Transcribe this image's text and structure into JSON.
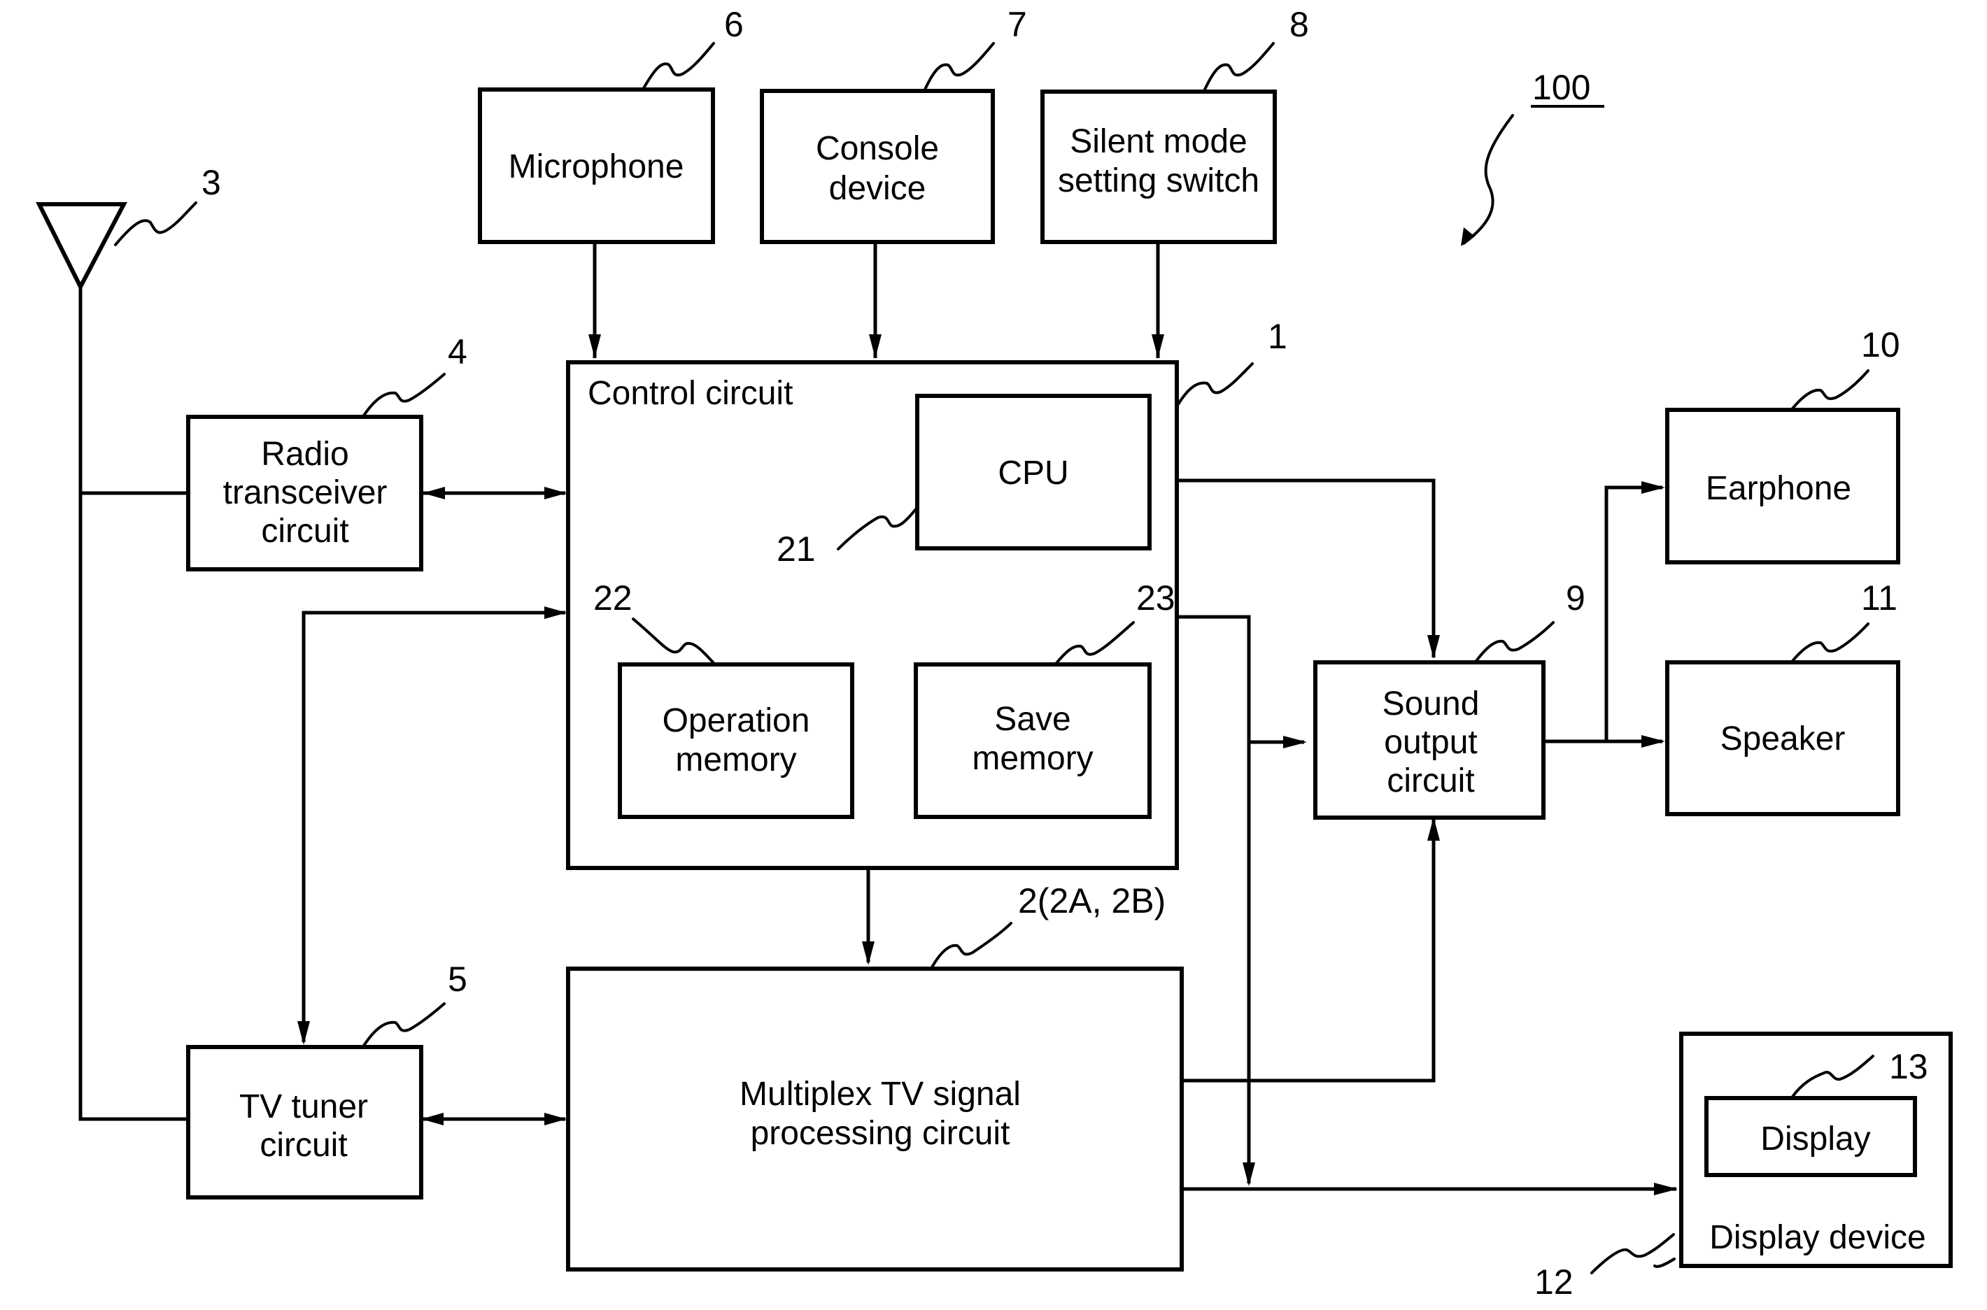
{
  "figure": {
    "reference": "100",
    "colors": {
      "ink": "#000000",
      "paper": "#ffffff"
    }
  },
  "blocks": {
    "control": {
      "label": "Control circuit",
      "ref": "1"
    },
    "multiplex": {
      "lines": [
        "Multiplex TV signal",
        "processing circuit"
      ],
      "ref": "2(2A, 2B)"
    },
    "antenna": {
      "ref": "3"
    },
    "radio": {
      "lines": [
        "Radio",
        "transceiver",
        "circuit"
      ],
      "ref": "4"
    },
    "tv_tuner": {
      "lines": [
        "TV tuner",
        "circuit"
      ],
      "ref": "5"
    },
    "microphone": {
      "lines": [
        "Microphone"
      ],
      "ref": "6"
    },
    "console": {
      "lines": [
        "Console",
        "device"
      ],
      "ref": "7"
    },
    "silent_switch": {
      "lines": [
        "Silent mode",
        "setting switch"
      ],
      "ref": "8"
    },
    "sound_output": {
      "lines": [
        "Sound",
        "output",
        "circuit"
      ],
      "ref": "9"
    },
    "earphone": {
      "lines": [
        "Earphone"
      ],
      "ref": "10"
    },
    "speaker": {
      "lines": [
        "Speaker"
      ],
      "ref": "11"
    },
    "display_device": {
      "label": "Display device",
      "ref": "12"
    },
    "display": {
      "lines": [
        "Display"
      ],
      "ref": "13"
    },
    "cpu": {
      "lines": [
        "CPU"
      ],
      "ref": "21"
    },
    "operation_memory": {
      "lines": [
        "Operation",
        "memory"
      ],
      "ref": "22"
    },
    "save_memory": {
      "lines": [
        "Save",
        "memory"
      ],
      "ref": "23"
    }
  }
}
